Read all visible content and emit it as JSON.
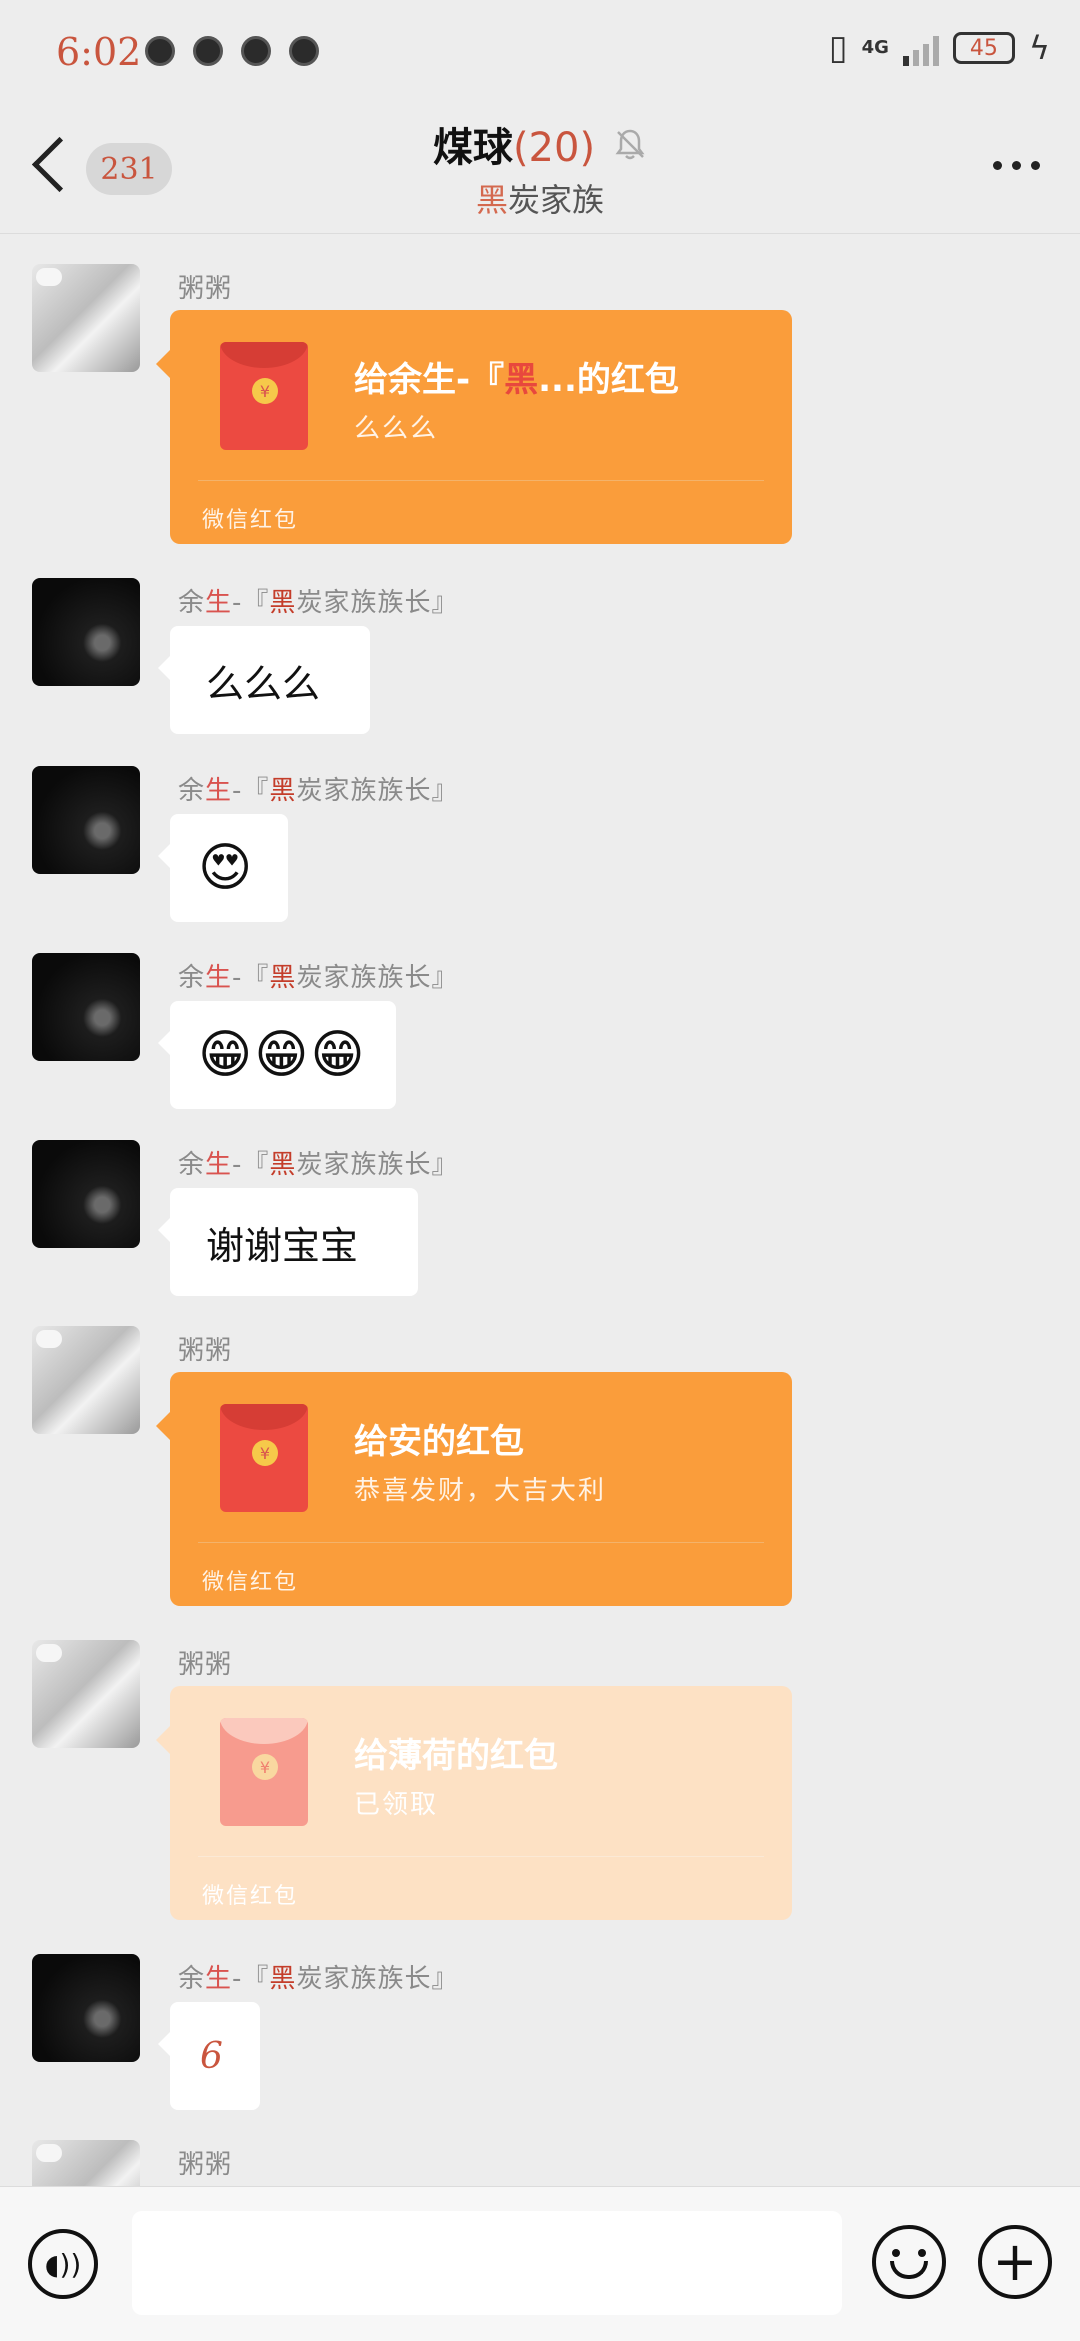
{
  "status_bar": {
    "time": "6:02",
    "network": "4G",
    "battery": "45"
  },
  "header": {
    "unread_count": "231",
    "title": "煤球",
    "member_count": "(20)",
    "subtitle_hl": "黑",
    "subtitle_rest": "炭家族"
  },
  "messages": [
    {
      "type": "redpacket",
      "sender": "粥粥",
      "title_a": "给余生-『",
      "title_hl": "黑",
      "title_b": "...的红包",
      "sub": "么么么",
      "footer": "微信红包"
    },
    {
      "type": "text",
      "sender_a": "余",
      "sender_hl": "生",
      "sender_b": "-『",
      "sender_hl2": "黑",
      "sender_c": "炭家族族长』",
      "text": "么么么"
    },
    {
      "type": "emoji",
      "sender_a": "余",
      "sender_hl": "生",
      "sender_b": "-『",
      "sender_hl2": "黑",
      "sender_c": "炭家族族长』",
      "text": "😍"
    },
    {
      "type": "emoji",
      "sender_a": "余",
      "sender_hl": "生",
      "sender_b": "-『",
      "sender_hl2": "黑",
      "sender_c": "炭家族族长』",
      "text": "😁😁😁"
    },
    {
      "type": "text",
      "sender_a": "余",
      "sender_hl": "生",
      "sender_b": "-『",
      "sender_hl2": "黑",
      "sender_c": "炭家族族长』",
      "text": "谢谢宝宝"
    },
    {
      "type": "redpacket",
      "sender": "粥粥",
      "title": "给安的红包",
      "sub": "恭喜发财，大吉大利",
      "footer": "微信红包"
    },
    {
      "type": "redpacket_opened",
      "sender": "粥粥",
      "title": "给薄荷的红包",
      "sub": "已领取",
      "footer": "微信红包"
    },
    {
      "type": "text",
      "sender_a": "余",
      "sender_hl": "生",
      "sender_b": "-『",
      "sender_hl2": "黑",
      "sender_c": "炭家族族长』",
      "text": "6"
    },
    {
      "type": "partial",
      "sender": "粥粥"
    }
  ],
  "icons": {
    "back": "chevron-left-icon",
    "mute": "bell-off-icon",
    "more": "more-dots-icon",
    "voice": "voice-icon",
    "emoji": "smile-icon",
    "plus": "plus-icon",
    "coin": "¥"
  }
}
